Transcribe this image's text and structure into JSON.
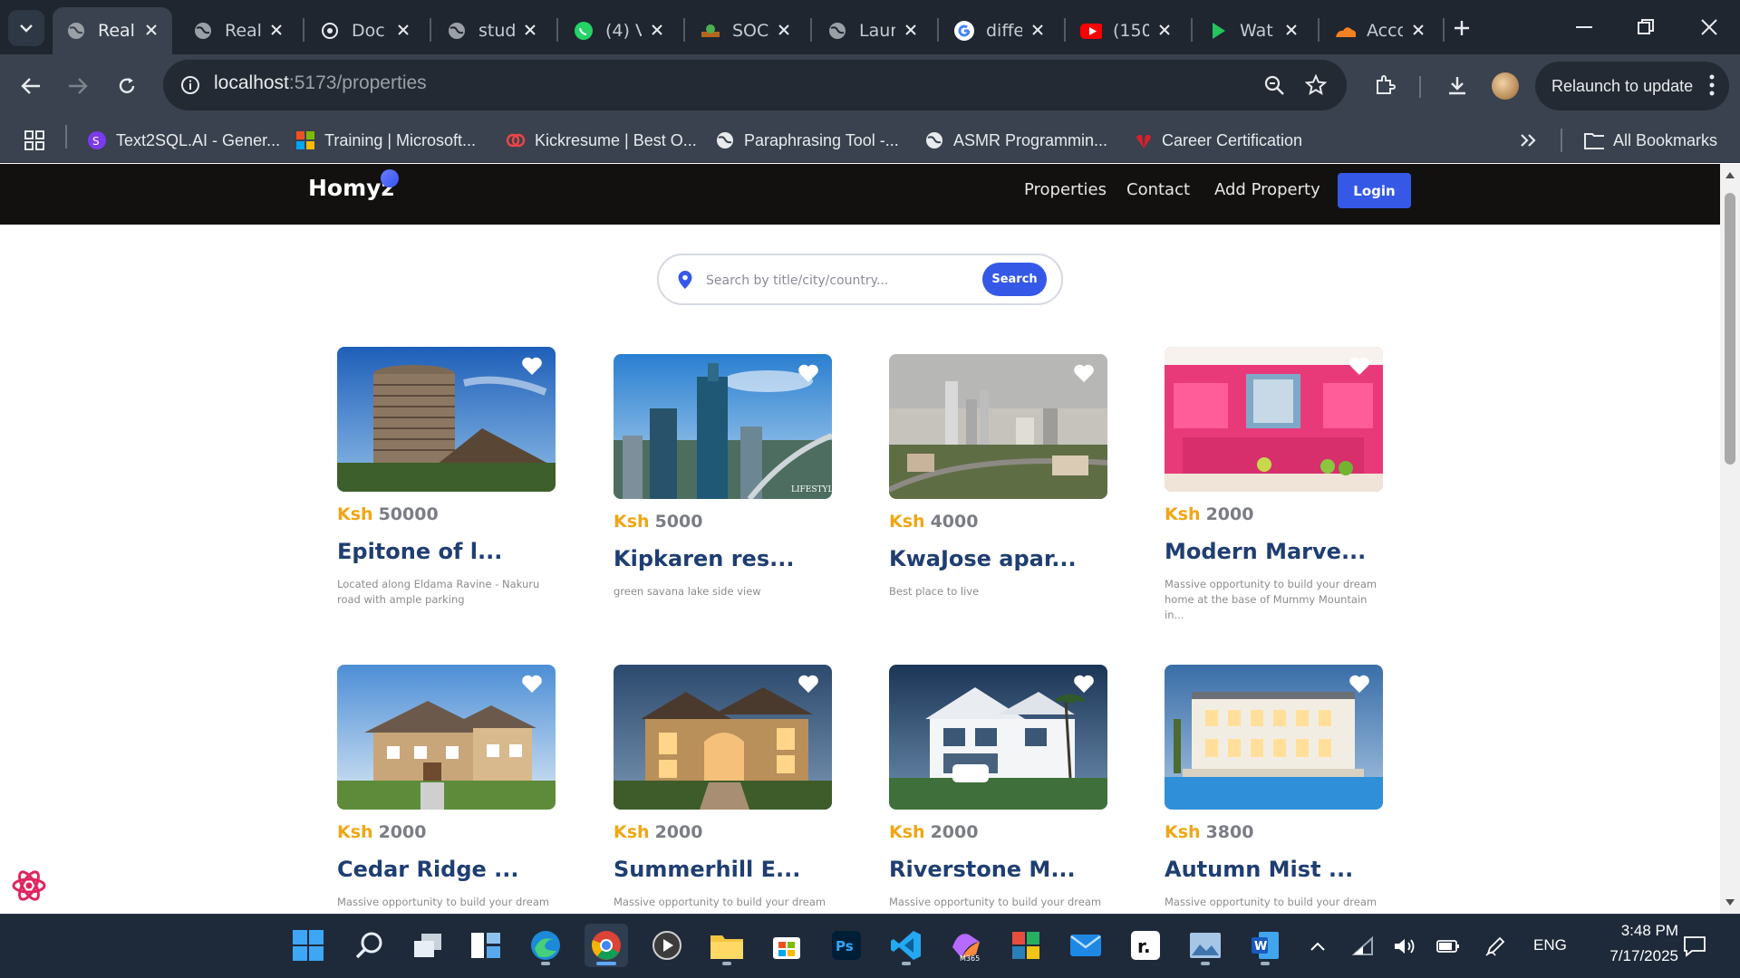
{
  "browser": {
    "tabs": [
      {
        "title": "Real",
        "icon": "globe-icon",
        "active": true
      },
      {
        "title": "Real",
        "icon": "globe-icon"
      },
      {
        "title": "Doc",
        "icon": "openai-icon"
      },
      {
        "title": "stud",
        "icon": "globe-icon"
      },
      {
        "title": "(4) V",
        "icon": "whatsapp-icon"
      },
      {
        "title": "SOC",
        "icon": "soc-icon"
      },
      {
        "title": "Laur",
        "icon": "globe-icon"
      },
      {
        "title": "diffe",
        "icon": "google-icon"
      },
      {
        "title": "(150",
        "icon": "youtube-icon"
      },
      {
        "title": "Wat",
        "icon": "play-icon"
      },
      {
        "title": "Acco",
        "icon": "cloudflare-icon"
      }
    ],
    "url_host": "localhost",
    "url_path": ":5173/properties",
    "relaunch_label": "Relaunch to update",
    "bookmarks": [
      {
        "label": "Text2SQL.AI - Gener...",
        "icon": "text2sql-icon"
      },
      {
        "label": "Training | Microsoft...",
        "icon": "microsoft-icon"
      },
      {
        "label": "Kickresume | Best O...",
        "icon": "kickresume-icon"
      },
      {
        "label": "Paraphrasing Tool -...",
        "icon": "globe-icon"
      },
      {
        "label": "ASMR Programmin...",
        "icon": "globe-icon"
      },
      {
        "label": "Career Certification",
        "icon": "huawei-icon"
      }
    ],
    "all_bookmarks_label": "All Bookmarks"
  },
  "site": {
    "logo": "Homyz",
    "nav": [
      "Properties",
      "Contact",
      "Add Property"
    ],
    "login_label": "Login",
    "search": {
      "placeholder": "Search by title/city/country...",
      "button_label": "Search"
    },
    "colors": {
      "header_bg": "#131110",
      "accent_blue": "#3559e6",
      "currency_orange": "#f0a614",
      "title_navy": "#1f3e72"
    }
  },
  "properties": [
    {
      "currency": "Ksh",
      "price": "50000",
      "title": "Epitone of l...",
      "description": "Located along Eldama Ravine - Nakuru road with ample parking",
      "image": "tower-building-photo"
    },
    {
      "currency": "Ksh",
      "price": "5000",
      "title": "Kipkaren res...",
      "description": "green savana lake side view",
      "image": "city-skyline-photo"
    },
    {
      "currency": "Ksh",
      "price": "4000",
      "title": "KwaJose apar...",
      "description": "Best place to live",
      "image": "city-aerial-photo"
    },
    {
      "currency": "Ksh",
      "price": "2000",
      "title": "Modern Marve...",
      "description": "Massive opportunity to build your dream home at the base of Mummy Mountain in...",
      "image": "pink-kitchen-photo"
    },
    {
      "currency": "Ksh",
      "price": "2000",
      "title": "Cedar Ridge ...",
      "description": "Massive opportunity to build your dream",
      "image": "suburban-house-photo"
    },
    {
      "currency": "Ksh",
      "price": "2000",
      "title": "Summerhill E...",
      "description": "Massive opportunity to build your dream",
      "image": "villa-evening-photo"
    },
    {
      "currency": "Ksh",
      "price": "2000",
      "title": "Riverstone M...",
      "description": "Massive opportunity to build your dream",
      "image": "modern-villa-photo"
    },
    {
      "currency": "Ksh",
      "price": "3800",
      "title": "Autumn Mist ...",
      "description": "Massive opportunity to build your dream",
      "image": "mansion-pool-photo"
    }
  ],
  "taskbar": {
    "apps": [
      "start-icon",
      "search-icon",
      "task-view-icon",
      "widgets-icon",
      "edge-icon",
      "chrome-icon",
      "media-player-icon",
      "file-explorer-icon",
      "store-icon",
      "photoshop-icon",
      "vscode-icon",
      "m365-copilot-icon",
      "office-icon",
      "mail-icon",
      "r-app-icon",
      "image-viewer-icon",
      "word-icon"
    ],
    "language": "ENG",
    "time": "3:48 PM",
    "date": "7/17/2025"
  }
}
